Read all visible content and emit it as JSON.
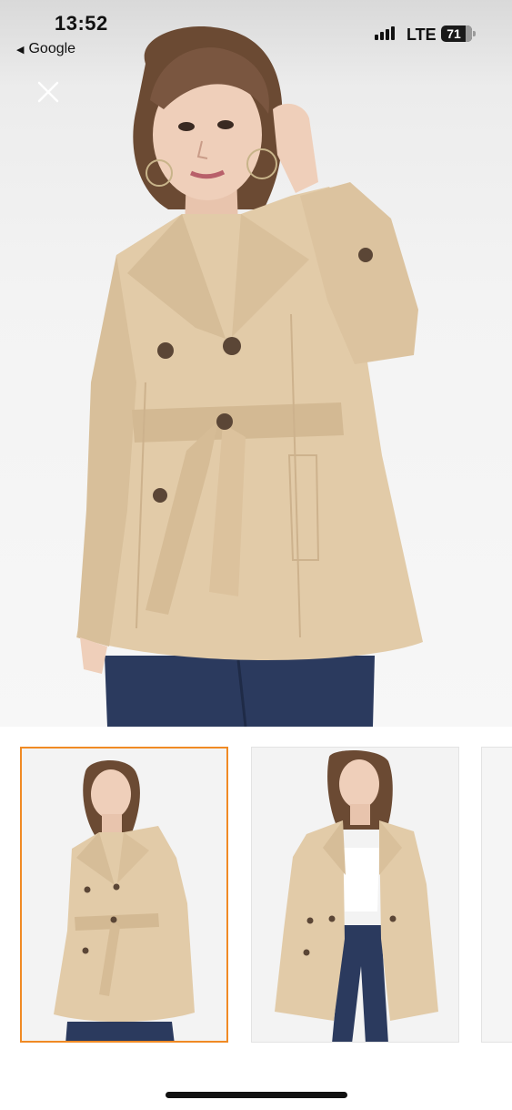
{
  "status_bar": {
    "time": "13:52",
    "back_app": "Google",
    "network": "LTE",
    "battery": "71"
  },
  "icons": {
    "close": "close-icon",
    "back": "back-triangle-icon",
    "signal": "cellular-signal-icon",
    "battery": "battery-icon"
  },
  "colors": {
    "coat": "#e2cba8",
    "jeans": "#2b3a5e",
    "selected_border": "#f08a24"
  },
  "gallery": {
    "selected_index": 0,
    "thumbnail_count": 3
  }
}
